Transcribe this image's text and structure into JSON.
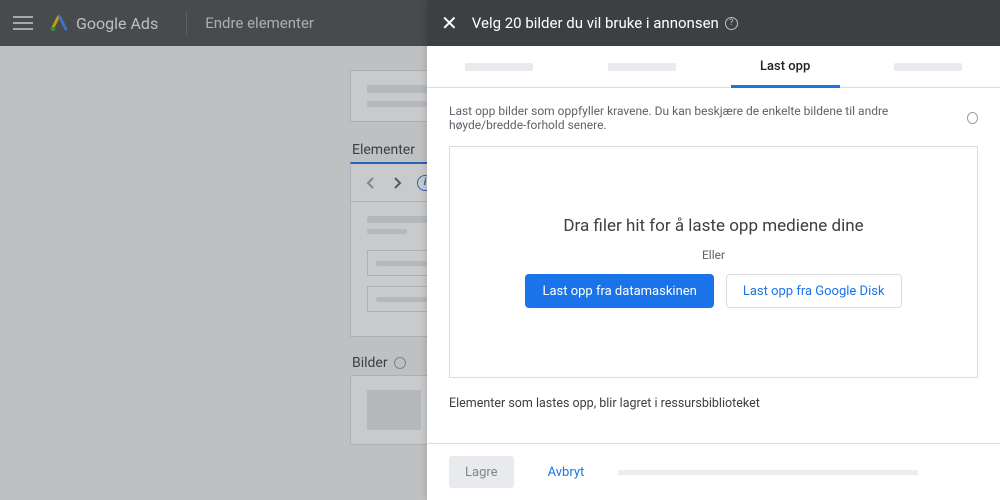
{
  "app": {
    "product": "Google Ads",
    "page": "Endre elementer",
    "sections": {
      "elements": "Elementer",
      "images": "Bilder"
    }
  },
  "dialog": {
    "title": "Velg 20 bilder du vil bruke i annonsen",
    "tabs": {
      "active": "Last opp"
    },
    "helper": "Last opp bilder som oppfyller kravene. Du kan beskjære de enkelte bildene til andre høyde/bredde-forhold senere.",
    "dropzone": {
      "headline": "Dra filer hit for å laste opp mediene dine",
      "or": "Eller",
      "upload_computer": "Last opp fra datamaskinen",
      "upload_drive": "Last opp fra Google Disk"
    },
    "library_note": "Elementer som lastes opp, blir lagret i ressursbiblioteket",
    "footer": {
      "save": "Lagre",
      "cancel": "Avbryt"
    }
  }
}
